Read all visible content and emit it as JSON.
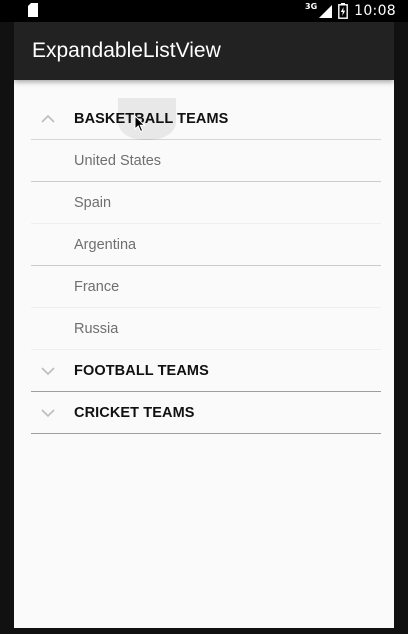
{
  "status_bar": {
    "network": "3G",
    "time": "10:08",
    "icons": [
      "sd-card-icon",
      "signal-icon",
      "battery-icon"
    ]
  },
  "app_bar": {
    "title": "ExpandableListView",
    "color": "#222222"
  },
  "list": {
    "groups": [
      {
        "label": "BASKETBALL TEAMS",
        "expanded": true,
        "icon": "chevron-up-icon",
        "children": [
          "United States",
          "Spain",
          "Argentina",
          "France",
          "Russia"
        ]
      },
      {
        "label": "FOOTBALL TEAMS",
        "expanded": false,
        "icon": "chevron-down-icon",
        "children": []
      },
      {
        "label": "CRICKET TEAMS",
        "expanded": false,
        "icon": "chevron-down-icon",
        "children": []
      }
    ]
  },
  "colors": {
    "background": "#fafafa",
    "group_text": "#111111",
    "child_text": "#6f6f6f",
    "chevron": "#bdbdbd"
  }
}
